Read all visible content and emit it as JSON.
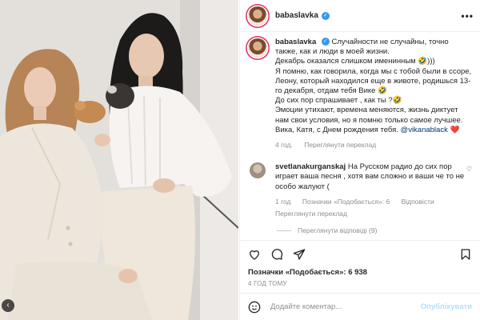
{
  "post": {
    "username": "babaslavka",
    "more_label": "•••",
    "caption_segments": {
      "p1": "Случайности не случайны, точно также, как и люди в моей жизни.",
      "p2": "Декабрь оказался слишком именинным 🤣)))",
      "p3": "Я помню, как говорила, когда мы с тобой были в ссоре, Леону, который находился еще в животе, родишься 13-го декабря, отдам тебя Вике 🤣",
      "p4": "До сих пор спрашивает , как ты ?🤣",
      "p5": "Эмоции утихают, времена меняются, жизнь диктует нам свои условия, но я помню только самое лучшее.",
      "p6": "Вика, Катя, с Днем рождения тебя. ",
      "mention": "@vikanablack",
      "heart": "❤️"
    },
    "caption_meta": {
      "age": "4 год.",
      "translate": "Переглянути переклад"
    },
    "comment": {
      "username": "svetlanakurganskaj",
      "text": "На Русском радио до сих пор играет ваша песня , хотя вам сложно и ваши че то не особо жалуют (",
      "age": "1 год",
      "likes": "Позначки «Подобається»: 6",
      "reply": "Відповісти",
      "translate": "Переглянути переклад",
      "view_replies": "Переглянути відповіді (9)"
    },
    "likes_label": "Позначки «Подобається»: 6 938",
    "posted_ago": "4 ГОД ТОМУ",
    "add_comment_placeholder": "Додайте коментар...",
    "publish_label": "Опублікувати"
  },
  "colors": {
    "verified": "#3897f0",
    "link": "#00376b",
    "muted": "#8e8e8e",
    "publish": "#b2dffc",
    "story_ring": "#e1306c"
  },
  "icons": [
    "more-icon",
    "verified-icon",
    "heart-icon",
    "comment-icon",
    "share-icon",
    "save-icon",
    "emoji-icon",
    "prev-arrow-icon"
  ]
}
